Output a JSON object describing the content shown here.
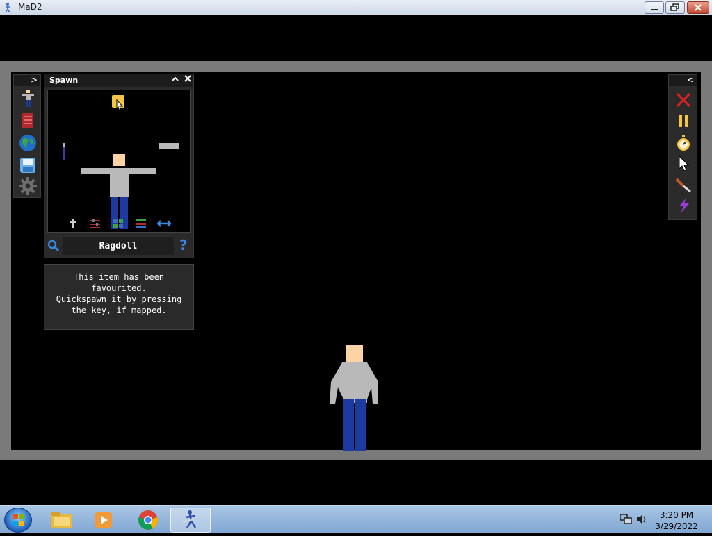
{
  "window": {
    "title": "MaD2",
    "minimize_icon": "minimize-icon",
    "maximize_icon": "restore-icon",
    "close_icon": "close-icon"
  },
  "left_toolbar": {
    "toggle": ">",
    "items": [
      {
        "name": "spawn-ragdoll-icon"
      },
      {
        "name": "book-icon"
      },
      {
        "name": "globe-icon"
      },
      {
        "name": "save-disk-icon"
      },
      {
        "name": "gear-icon"
      }
    ]
  },
  "spawn_panel": {
    "title": "Spawn",
    "collapse": "^",
    "close": "✕",
    "selected_name": "Ragdoll",
    "help": "?",
    "category_icons": [
      "pin-icon",
      "sliders-icon",
      "grid-icon",
      "stack-icon",
      "swap-arrows-icon"
    ]
  },
  "tooltip": {
    "lines": [
      "This item has been",
      "favourited.",
      "Quickspawn it by pressing",
      "the key, if mapped."
    ]
  },
  "right_toolbar": {
    "toggle": "<",
    "items": [
      {
        "name": "delete-x-icon"
      },
      {
        "name": "pause-icon"
      },
      {
        "name": "stopwatch-icon"
      },
      {
        "name": "cursor-icon"
      },
      {
        "name": "knife-icon"
      },
      {
        "name": "lightning-icon"
      }
    ]
  },
  "colors": {
    "skin": "#fdd3a6",
    "shirt": "#b9b9b9",
    "pants": "#1c3aa0",
    "viewport_frame": "#7a7a7a",
    "favourite": "#f5c443"
  },
  "taskbar": {
    "apps": [
      "file-explorer-icon",
      "media-player-icon",
      "chrome-icon",
      "mad2-icon"
    ],
    "time": "3:20 PM",
    "date": "3/29/2022"
  }
}
